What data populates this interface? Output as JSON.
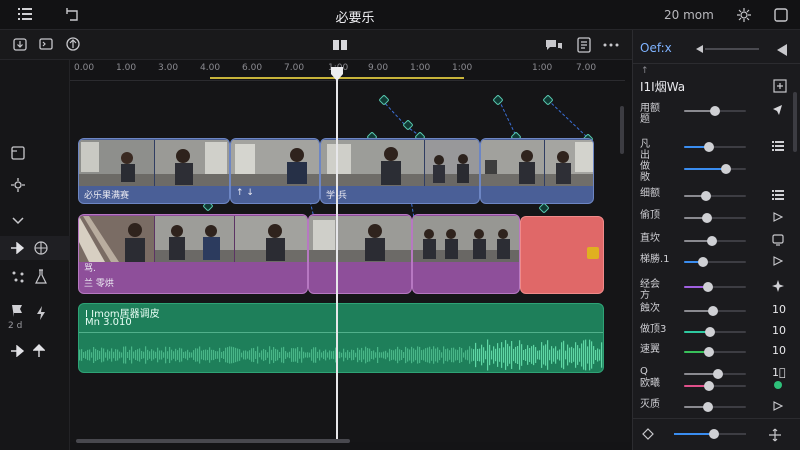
{
  "app": {
    "title": "必要乐",
    "time": "20 mom"
  },
  "ruler": {
    "ticks": [
      "0.00",
      "1.00",
      "3.00",
      "4.00",
      "6.00",
      "7.00",
      "1:00",
      "9.00",
      "1:00",
      "1:00",
      "1:00",
      "7.00"
    ]
  },
  "clips": {
    "video_label_1": "必乐果满赛",
    "video_label_2": "↑ ↓",
    "video_label_3": "学 兵",
    "pip_label_a": "骂.",
    "pip_label_b": "兰 零烘"
  },
  "audio": {
    "title": "I  Imom居器调皮",
    "sub": "Mn 3.010"
  },
  "left": {
    "small_text": "2 d"
  },
  "panel": {
    "tab": "Oef:x",
    "sub": "I1I烟Wa",
    "rows": [
      {
        "label": "用额\n题",
        "value": 0.5,
        "fill": "#8a8a90",
        "icon": "cursor"
      },
      {
        "label": "凡\n出",
        "value": 0.4,
        "fill": "#3a8df0",
        "icon": "list"
      },
      {
        "label": "做\n敞",
        "value": 0.68,
        "fill": "#3a8df0",
        "icon": ""
      },
      {
        "label": "细额",
        "value": 0.35,
        "fill": "#8a8a90",
        "icon": "list"
      },
      {
        "label": "偷顶",
        "value": 0.37,
        "fill": "#8a8a90",
        "icon": "play"
      },
      {
        "label": "直坎",
        "value": 0.45,
        "fill": "#8a8a90",
        "icon": "screen"
      },
      {
        "label": "梯勝.1",
        "value": 0.3,
        "fill": "#3a8df0",
        "icon": "play"
      },
      {
        "label": "经会\n方",
        "value": 0.38,
        "fill": "#a060e0",
        "icon": "sparkle"
      },
      {
        "label": "蝕次",
        "value": 0.47,
        "fill": "#8a8a90",
        "icon": "",
        "text": "10"
      },
      {
        "label": "做顶3",
        "value": 0.42,
        "fill": "#2ec9a0",
        "icon": "",
        "text": "10"
      },
      {
        "label": "速翼",
        "value": 0.4,
        "fill": "#38c05a",
        "icon": "",
        "text": "10"
      },
      {
        "label": "Q",
        "value": 0.55,
        "fill": "#8a8a90",
        "icon": "",
        "text": "1⃣"
      },
      {
        "label": "欧曦",
        "value": 0.4,
        "fill": "#e0508a",
        "icon": "dot"
      },
      {
        "label": "灭质",
        "value": 0.38,
        "fill": "#8a8a90",
        "icon": "play"
      }
    ],
    "footer_value": 0.55
  }
}
